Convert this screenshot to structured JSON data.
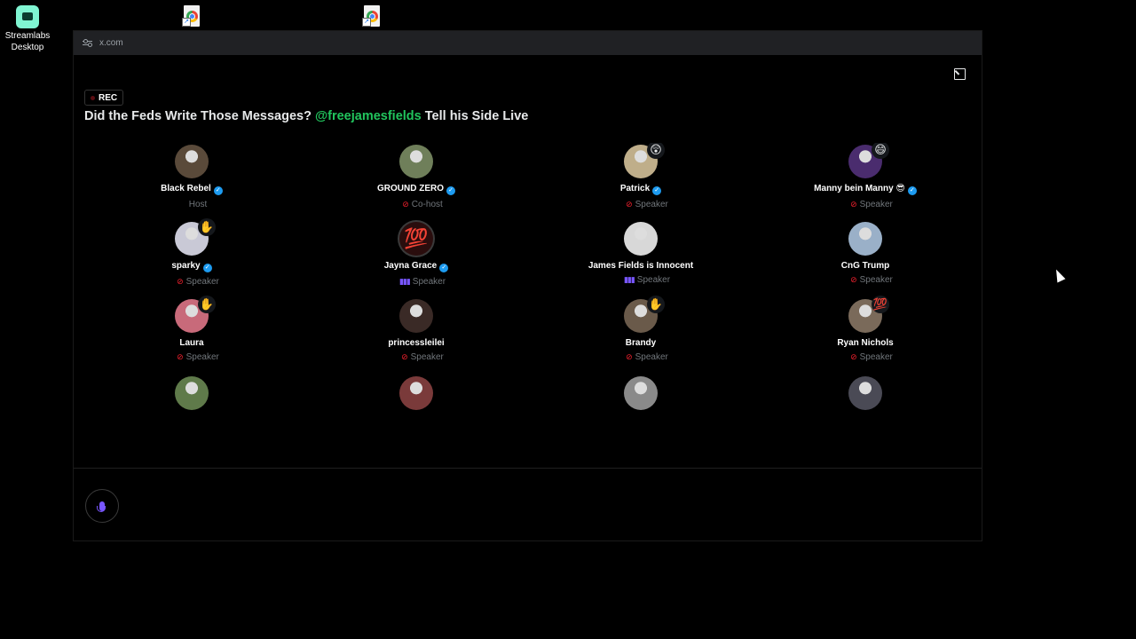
{
  "desktop": {
    "streamlabs_label": "Streamlabs Desktop",
    "shortcut_icons": [
      "chrome-shortcut-icon",
      "chrome-shortcut-icon"
    ]
  },
  "browser": {
    "url": "x.com"
  },
  "space": {
    "rec_label": "REC",
    "title_prefix": "Did the Feds Write Those Messages? ",
    "title_mention": "@freejamesfields",
    "title_suffix": " Tell his Side Live",
    "participants": [
      {
        "name": "Black Rebel",
        "role": "Host",
        "verified": true,
        "muted": false,
        "speaking": false,
        "reaction": "",
        "avatar_color": "#5a4a3a"
      },
      {
        "name": "GROUND ZERO",
        "role": "Co-host",
        "verified": true,
        "muted": true,
        "speaking": false,
        "reaction": "",
        "avatar_color": "#6f7f5a"
      },
      {
        "name": "Patrick",
        "role": "Speaker",
        "verified": true,
        "muted": true,
        "speaking": false,
        "reaction": "😲",
        "avatar_color": "#bfae8a"
      },
      {
        "name": "Manny bein Manny 😎",
        "role": "Speaker",
        "verified": true,
        "muted": true,
        "speaking": false,
        "reaction": "😄",
        "avatar_color": "#4a2c6e"
      },
      {
        "name": "sparky",
        "role": "Speaker",
        "verified": true,
        "muted": true,
        "speaking": false,
        "reaction": "✋",
        "avatar_color": "#c9c9d6"
      },
      {
        "name": "Jayna Grace",
        "role": "Speaker",
        "verified": true,
        "muted": false,
        "speaking": true,
        "reaction": "",
        "avatar_color": "#2a0d0d",
        "avatar_text": "💯"
      },
      {
        "name": "James Fields is Innocent",
        "role": "Speaker",
        "verified": false,
        "muted": false,
        "speaking": true,
        "reaction": "",
        "avatar_color": "#d8d8d8"
      },
      {
        "name": "CnG Trump",
        "role": "Speaker",
        "verified": false,
        "muted": true,
        "speaking": false,
        "reaction": "",
        "avatar_color": "#9ab0c8"
      },
      {
        "name": "Laura",
        "role": "Speaker",
        "verified": false,
        "muted": true,
        "speaking": false,
        "reaction": "✋",
        "avatar_color": "#c86a7a"
      },
      {
        "name": "princessleilei",
        "role": "Speaker",
        "verified": false,
        "muted": true,
        "speaking": false,
        "reaction": "",
        "avatar_color": "#3a2a26"
      },
      {
        "name": "Brandy",
        "role": "Speaker",
        "verified": false,
        "muted": true,
        "speaking": false,
        "reaction": "✋",
        "avatar_color": "#6a5a4a"
      },
      {
        "name": "Ryan Nichols",
        "role": "Speaker",
        "verified": false,
        "muted": true,
        "speaking": false,
        "reaction": "💯",
        "avatar_color": "#7a6a5a"
      },
      {
        "name": "",
        "role": "",
        "verified": false,
        "muted": false,
        "speaking": false,
        "reaction": "",
        "avatar_color": "#5f7a4a"
      },
      {
        "name": "",
        "role": "",
        "verified": false,
        "muted": false,
        "speaking": false,
        "reaction": "",
        "avatar_color": "#7a3a3a"
      },
      {
        "name": "",
        "role": "",
        "verified": false,
        "muted": false,
        "speaking": false,
        "reaction": "",
        "avatar_color": "#8a8a8a"
      },
      {
        "name": "",
        "role": "",
        "verified": false,
        "muted": false,
        "speaking": false,
        "reaction": "",
        "avatar_color": "#4a4a55"
      }
    ]
  },
  "colors": {
    "mention": "#21c45d",
    "verified": "#1d9bf0",
    "muted": "#f4212e",
    "accent": "#7856ff"
  },
  "icons": {
    "expand": "expand-icon",
    "mic": "microphone-icon",
    "url_settings": "site-settings-icon"
  }
}
